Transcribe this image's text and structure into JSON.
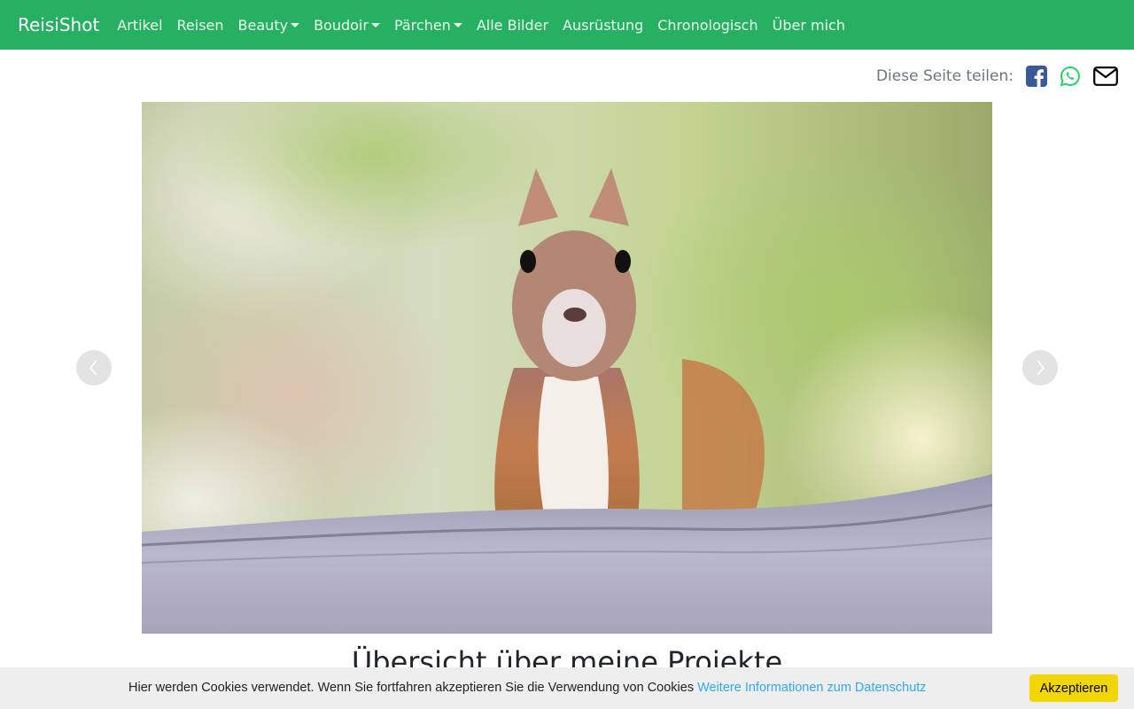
{
  "nav": {
    "brand": "ReisiShot",
    "items": [
      {
        "label": "Artikel",
        "dropdown": false
      },
      {
        "label": "Reisen",
        "dropdown": false
      },
      {
        "label": "Beauty",
        "dropdown": true
      },
      {
        "label": "Boudoir",
        "dropdown": true
      },
      {
        "label": "Pärchen",
        "dropdown": true
      },
      {
        "label": "Alle Bilder",
        "dropdown": false
      },
      {
        "label": "Ausrüstung",
        "dropdown": false
      },
      {
        "label": "Chronologisch",
        "dropdown": false
      },
      {
        "label": "Über mich",
        "dropdown": false
      }
    ],
    "color": "#28b062"
  },
  "share": {
    "label": "Diese Seite teilen:",
    "icons": [
      "facebook-icon",
      "whatsapp-icon",
      "email-icon"
    ],
    "colors": {
      "facebook": "#3b5998",
      "whatsapp": "#25d366",
      "email": "#000000"
    }
  },
  "carousel": {
    "image": "red-squirrel-photo",
    "prev_icon": "chevron-left-icon",
    "next_icon": "chevron-right-icon"
  },
  "main": {
    "heading": "Übersicht über meine Projekte"
  },
  "cookie": {
    "text": "Hier werden Cookies verwendet. Wenn Sie fortfahren akzeptieren Sie die Verwendung von Cookies",
    "link": "Weitere Informationen zum Datenschutz",
    "button": "Akzeptieren",
    "button_color": "#f1d600",
    "link_color": "#31a8f0"
  }
}
